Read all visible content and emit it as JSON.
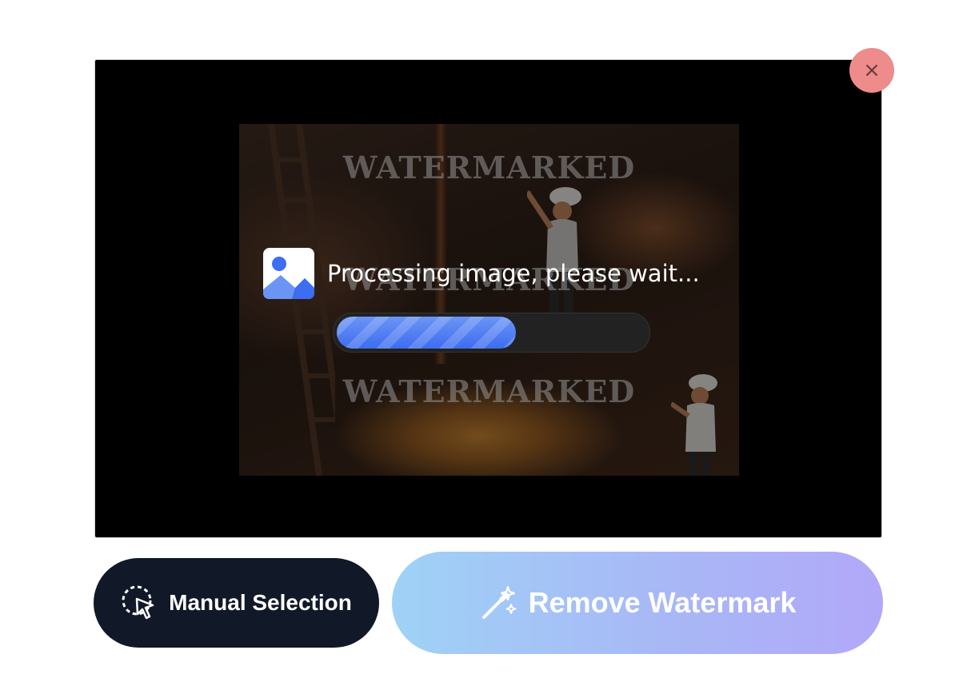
{
  "overlay": {
    "watermark_text": "WATERMARKED",
    "processing_text": "Processing image, please wait...",
    "progress_fraction": 0.58,
    "icons": {
      "processing": "image-icon",
      "close": "close-icon"
    },
    "close_symbol": "×"
  },
  "actions": {
    "manual_selection_label": "Manual Selection",
    "manual_selection_icon": "cursor-selection-icon",
    "remove_watermark_label": "Remove Watermark",
    "remove_watermark_icon": "magic-wand-icon"
  },
  "colors": {
    "primary_blue": "#3d6df0",
    "dark_button": "#111827",
    "close_button": "#ee8b8b",
    "gradient_start": "#9fd2f6",
    "gradient_end": "#b1a8f8"
  }
}
